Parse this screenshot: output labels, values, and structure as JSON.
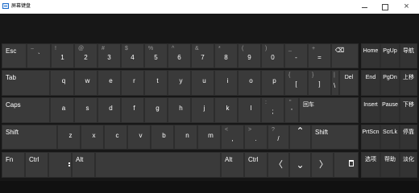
{
  "window": {
    "title": "屏幕键盘"
  },
  "keys": {
    "esc": "Esc",
    "backtick": {
      "primary": "`",
      "secondary": "~"
    },
    "n1": {
      "primary": "1",
      "secondary": "!"
    },
    "n2": {
      "primary": "2",
      "secondary": "@"
    },
    "n3": {
      "primary": "3",
      "secondary": "#"
    },
    "n4": {
      "primary": "4",
      "secondary": "$"
    },
    "n5": {
      "primary": "5",
      "secondary": "%"
    },
    "n6": {
      "primary": "6",
      "secondary": "^"
    },
    "n7": {
      "primary": "7",
      "secondary": "&"
    },
    "n8": {
      "primary": "8",
      "secondary": "*"
    },
    "n9": {
      "primary": "9",
      "secondary": "("
    },
    "n0": {
      "primary": "0",
      "secondary": ")"
    },
    "minus": {
      "primary": "-",
      "secondary": "_"
    },
    "equals": {
      "primary": "=",
      "secondary": "+"
    },
    "backspace": "⌫",
    "tab": "Tab",
    "q": "q",
    "w": "w",
    "e": "e",
    "r": "r",
    "t": "t",
    "y": "y",
    "u": "u",
    "i": "i",
    "o": "o",
    "p": "p",
    "lbrace": {
      "primary": "[",
      "secondary": "{"
    },
    "rbrace": {
      "primary": "]",
      "secondary": "}"
    },
    "backslash": {
      "primary": "\\",
      "secondary": "|"
    },
    "del": "Del",
    "caps": "Caps",
    "a": "a",
    "s": "s",
    "d": "d",
    "f": "f",
    "g": "g",
    "h": "h",
    "j": "j",
    "k": "k",
    "l": "l",
    "semicolon": {
      "primary": ";",
      "secondary": ":"
    },
    "quote": {
      "primary": "'",
      "secondary": "\""
    },
    "enter": "回车",
    "shift_left": "Shift",
    "z": "z",
    "x": "x",
    "c": "c",
    "v": "v",
    "b": "b",
    "n": "n",
    "m": "m",
    "comma": {
      "primary": ",",
      "secondary": "<"
    },
    "period": {
      "primary": ".",
      "secondary": ">"
    },
    "slash": {
      "primary": "/",
      "secondary": "?"
    },
    "up": "⌃",
    "shift_right": "Shift",
    "fn": "Fn",
    "ctrl_left": "Ctrl",
    "windows": "",
    "alt_left": "Alt",
    "alt_right": "Alt",
    "ctrl_right": "Ctrl",
    "left": "〈",
    "down": "⌄",
    "right": "〉",
    "home": "Home",
    "pgup": "PgUp",
    "nav": "导航",
    "end": "End",
    "pgdn": "PgDn",
    "move_up": "上移",
    "insert": "Insert",
    "pause": "Pause",
    "move_down": "下移",
    "prtscn": "PrtScn",
    "scrlk": "ScrLk",
    "dock": "停靠",
    "options": "选项",
    "help": "帮助",
    "fade": "淡化"
  },
  "colors": {
    "key_bg": "#3a3a3a",
    "key_bg_dark": "#333333",
    "keyboard_bg": "#171717",
    "title_bg": "#ffffff",
    "text": "#ffffff",
    "secondary_text": "#9a9a9a"
  }
}
